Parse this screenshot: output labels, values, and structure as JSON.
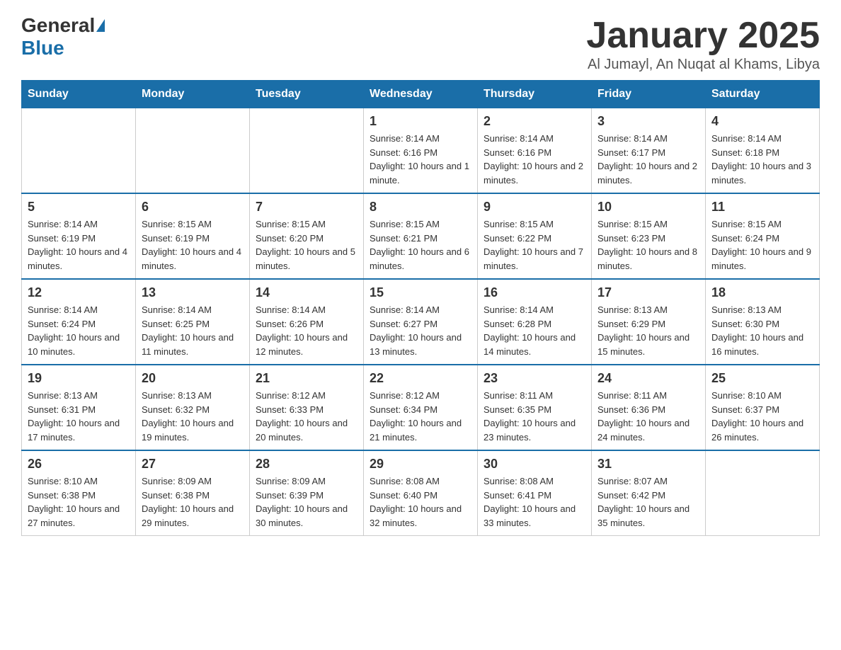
{
  "logo": {
    "general": "General",
    "blue": "Blue"
  },
  "title": "January 2025",
  "subtitle": "Al Jumayl, An Nuqat al Khams, Libya",
  "headers": [
    "Sunday",
    "Monday",
    "Tuesday",
    "Wednesday",
    "Thursday",
    "Friday",
    "Saturday"
  ],
  "weeks": [
    [
      {
        "day": "",
        "info": ""
      },
      {
        "day": "",
        "info": ""
      },
      {
        "day": "",
        "info": ""
      },
      {
        "day": "1",
        "info": "Sunrise: 8:14 AM\nSunset: 6:16 PM\nDaylight: 10 hours and 1 minute."
      },
      {
        "day": "2",
        "info": "Sunrise: 8:14 AM\nSunset: 6:16 PM\nDaylight: 10 hours and 2 minutes."
      },
      {
        "day": "3",
        "info": "Sunrise: 8:14 AM\nSunset: 6:17 PM\nDaylight: 10 hours and 2 minutes."
      },
      {
        "day": "4",
        "info": "Sunrise: 8:14 AM\nSunset: 6:18 PM\nDaylight: 10 hours and 3 minutes."
      }
    ],
    [
      {
        "day": "5",
        "info": "Sunrise: 8:14 AM\nSunset: 6:19 PM\nDaylight: 10 hours and 4 minutes."
      },
      {
        "day": "6",
        "info": "Sunrise: 8:15 AM\nSunset: 6:19 PM\nDaylight: 10 hours and 4 minutes."
      },
      {
        "day": "7",
        "info": "Sunrise: 8:15 AM\nSunset: 6:20 PM\nDaylight: 10 hours and 5 minutes."
      },
      {
        "day": "8",
        "info": "Sunrise: 8:15 AM\nSunset: 6:21 PM\nDaylight: 10 hours and 6 minutes."
      },
      {
        "day": "9",
        "info": "Sunrise: 8:15 AM\nSunset: 6:22 PM\nDaylight: 10 hours and 7 minutes."
      },
      {
        "day": "10",
        "info": "Sunrise: 8:15 AM\nSunset: 6:23 PM\nDaylight: 10 hours and 8 minutes."
      },
      {
        "day": "11",
        "info": "Sunrise: 8:15 AM\nSunset: 6:24 PM\nDaylight: 10 hours and 9 minutes."
      }
    ],
    [
      {
        "day": "12",
        "info": "Sunrise: 8:14 AM\nSunset: 6:24 PM\nDaylight: 10 hours and 10 minutes."
      },
      {
        "day": "13",
        "info": "Sunrise: 8:14 AM\nSunset: 6:25 PM\nDaylight: 10 hours and 11 minutes."
      },
      {
        "day": "14",
        "info": "Sunrise: 8:14 AM\nSunset: 6:26 PM\nDaylight: 10 hours and 12 minutes."
      },
      {
        "day": "15",
        "info": "Sunrise: 8:14 AM\nSunset: 6:27 PM\nDaylight: 10 hours and 13 minutes."
      },
      {
        "day": "16",
        "info": "Sunrise: 8:14 AM\nSunset: 6:28 PM\nDaylight: 10 hours and 14 minutes."
      },
      {
        "day": "17",
        "info": "Sunrise: 8:13 AM\nSunset: 6:29 PM\nDaylight: 10 hours and 15 minutes."
      },
      {
        "day": "18",
        "info": "Sunrise: 8:13 AM\nSunset: 6:30 PM\nDaylight: 10 hours and 16 minutes."
      }
    ],
    [
      {
        "day": "19",
        "info": "Sunrise: 8:13 AM\nSunset: 6:31 PM\nDaylight: 10 hours and 17 minutes."
      },
      {
        "day": "20",
        "info": "Sunrise: 8:13 AM\nSunset: 6:32 PM\nDaylight: 10 hours and 19 minutes."
      },
      {
        "day": "21",
        "info": "Sunrise: 8:12 AM\nSunset: 6:33 PM\nDaylight: 10 hours and 20 minutes."
      },
      {
        "day": "22",
        "info": "Sunrise: 8:12 AM\nSunset: 6:34 PM\nDaylight: 10 hours and 21 minutes."
      },
      {
        "day": "23",
        "info": "Sunrise: 8:11 AM\nSunset: 6:35 PM\nDaylight: 10 hours and 23 minutes."
      },
      {
        "day": "24",
        "info": "Sunrise: 8:11 AM\nSunset: 6:36 PM\nDaylight: 10 hours and 24 minutes."
      },
      {
        "day": "25",
        "info": "Sunrise: 8:10 AM\nSunset: 6:37 PM\nDaylight: 10 hours and 26 minutes."
      }
    ],
    [
      {
        "day": "26",
        "info": "Sunrise: 8:10 AM\nSunset: 6:38 PM\nDaylight: 10 hours and 27 minutes."
      },
      {
        "day": "27",
        "info": "Sunrise: 8:09 AM\nSunset: 6:38 PM\nDaylight: 10 hours and 29 minutes."
      },
      {
        "day": "28",
        "info": "Sunrise: 8:09 AM\nSunset: 6:39 PM\nDaylight: 10 hours and 30 minutes."
      },
      {
        "day": "29",
        "info": "Sunrise: 8:08 AM\nSunset: 6:40 PM\nDaylight: 10 hours and 32 minutes."
      },
      {
        "day": "30",
        "info": "Sunrise: 8:08 AM\nSunset: 6:41 PM\nDaylight: 10 hours and 33 minutes."
      },
      {
        "day": "31",
        "info": "Sunrise: 8:07 AM\nSunset: 6:42 PM\nDaylight: 10 hours and 35 minutes."
      },
      {
        "day": "",
        "info": ""
      }
    ]
  ]
}
